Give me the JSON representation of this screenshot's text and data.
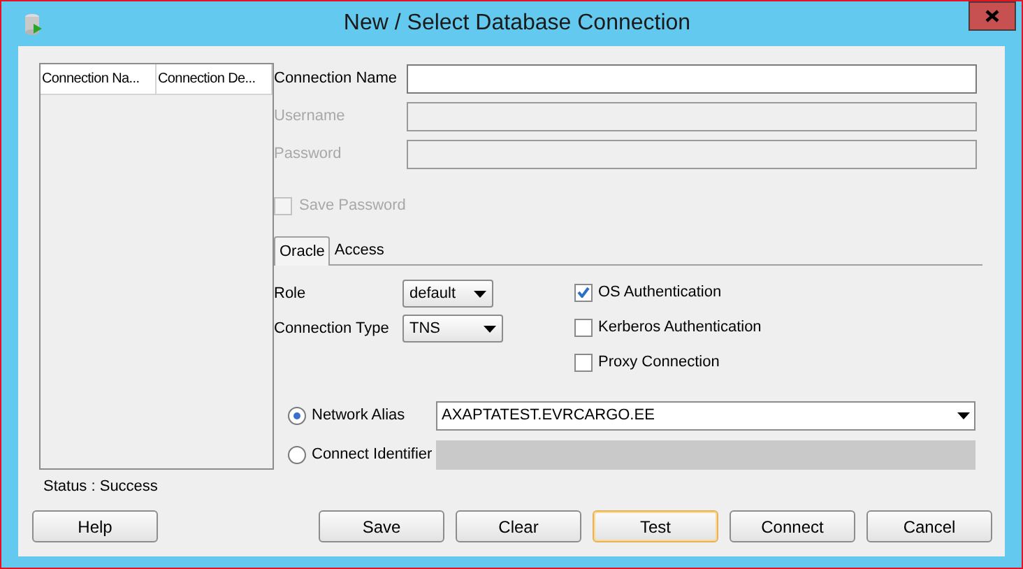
{
  "window": {
    "title": "New / Select Database Connection"
  },
  "connections_table": {
    "columns": [
      "Connection Na...",
      "Connection De..."
    ]
  },
  "fields": [
    {
      "label": "Connection Name",
      "disabled": false
    },
    {
      "label": "Username",
      "disabled": true
    },
    {
      "label": "Password",
      "disabled": true
    }
  ],
  "save_password": {
    "label": "Save Password",
    "checked": false,
    "disabled": true
  },
  "tabs": [
    {
      "label": "Oracle",
      "selected": true
    },
    {
      "label": "Access",
      "selected": false
    }
  ],
  "dropdowns": [
    {
      "label": "Role",
      "value": "default"
    },
    {
      "label": "Connection Type",
      "value": "TNS"
    }
  ],
  "checkboxes": [
    {
      "label": "OS Authentication",
      "checked": true
    },
    {
      "label": "Kerberos Authentication",
      "checked": false
    },
    {
      "label": "Proxy Connection",
      "checked": false
    }
  ],
  "radios": [
    {
      "label": "Network Alias",
      "selected": true,
      "value": "AXAPTATEST.EVRCARGO.EE"
    },
    {
      "label": "Connect Identifier",
      "selected": false
    }
  ],
  "status": "Status : Success",
  "buttons": [
    {
      "label": "Help",
      "default": false
    },
    {
      "label": "Save",
      "default": false
    },
    {
      "label": "Clear",
      "default": false
    },
    {
      "label": "Test",
      "default": true
    },
    {
      "label": "Connect",
      "default": false
    },
    {
      "label": "Cancel",
      "default": false
    }
  ]
}
